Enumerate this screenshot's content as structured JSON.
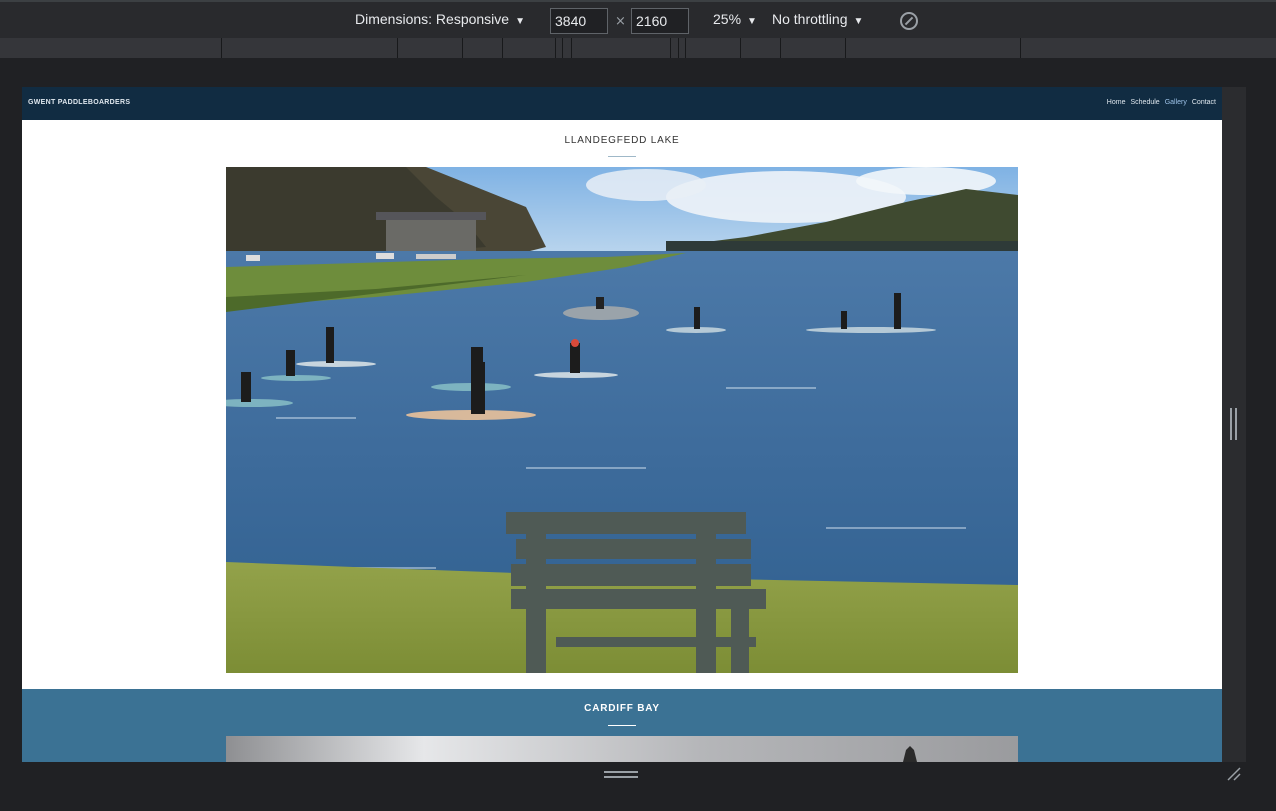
{
  "devtools": {
    "dimensions_label": "Dimensions: Responsive",
    "width_value": "3840",
    "times": "×",
    "height_value": "2160",
    "zoom_label": "25%",
    "throttling_label": "No throttling",
    "caret": "▼"
  },
  "site": {
    "brand": "GWENT PADDLEBOARDERS",
    "nav": [
      "Home",
      "Schedule",
      "Gallery",
      "Contact"
    ],
    "active_nav": "Gallery",
    "sections": [
      {
        "title": "LLANDEGFEDD LAKE"
      },
      {
        "title": "CARDIFF BAY"
      }
    ]
  },
  "colors": {
    "nav_bg": "#112c42",
    "bay_bg": "#3b7294",
    "devtools_bg": "#292a2d"
  }
}
